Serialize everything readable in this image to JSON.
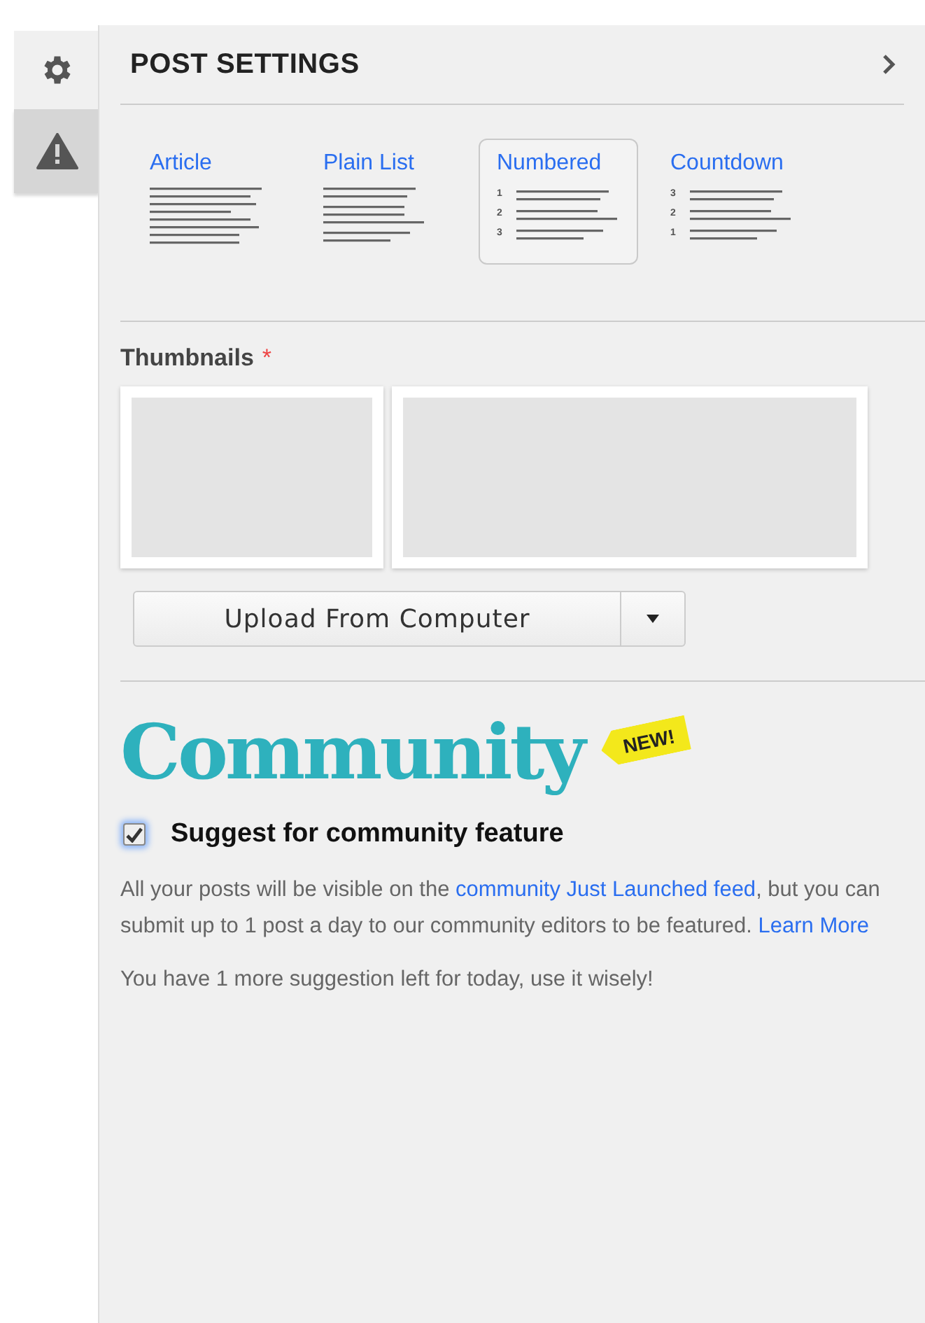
{
  "side_tabs": [
    {
      "kind": "gear",
      "selected": false
    },
    {
      "kind": "warning",
      "selected": true
    }
  ],
  "panel": {
    "title": "POST SETTINGS"
  },
  "layouts": [
    {
      "label": "Article",
      "kind": "text",
      "selected": false
    },
    {
      "label": "Plain List",
      "kind": "list",
      "selected": false
    },
    {
      "label": "Numbered",
      "kind": "numbered",
      "numbers": [
        "1",
        "2",
        "3"
      ],
      "selected": true
    },
    {
      "label": "Countdown",
      "kind": "numbered",
      "numbers": [
        "3",
        "2",
        "1"
      ],
      "selected": false
    }
  ],
  "thumbnails": {
    "label": "Thumbnails",
    "required_mark": "*",
    "upload_button": "Upload From Computer"
  },
  "community": {
    "logo": "Community",
    "badge": "NEW!",
    "checkbox": {
      "label": "Suggest for community feature",
      "checked": true
    },
    "description": [
      {
        "kind": "text",
        "text": "All your posts will be visible on the "
      },
      {
        "kind": "link",
        "text": "community Just Launched feed"
      },
      {
        "kind": "text",
        "text": ", but you can submit up to 1 post a day to our community editors to be featured. "
      },
      {
        "kind": "link",
        "text": "Learn More"
      }
    ],
    "note": "You have 1 more suggestion left for today, use it wisely!"
  }
}
